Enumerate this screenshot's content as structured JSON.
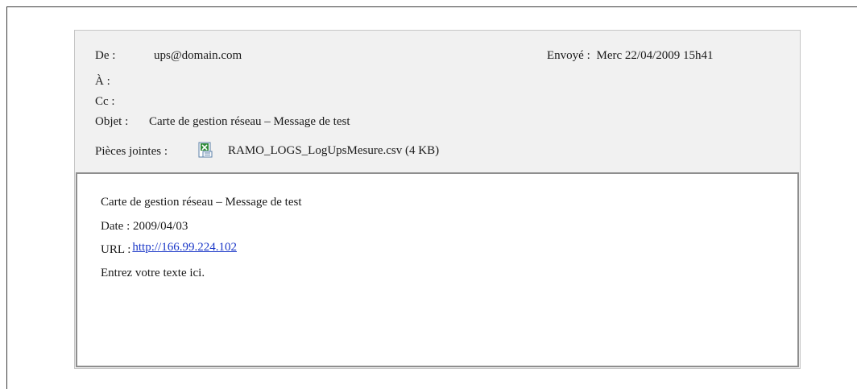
{
  "header": {
    "from_label": "De :",
    "from_value": "ups@domain.com",
    "sent_label": "Envoyé :",
    "sent_value": "Merc 22/04/2009 15h41",
    "to_label": "À :",
    "cc_label": "Cc :",
    "subject_label": "Objet :",
    "subject_value": "Carte de gestion réseau – Message de test",
    "attachments_label": "Pièces jointes :",
    "attachment_icon": "excel-csv-file-icon",
    "attachment_name": "RAMO_LOGS_LogUpsMesure.csv (4 KB)"
  },
  "body": {
    "line1": "Carte de  gestion réseau – Message de test",
    "date_line": "Date : 2009/04/03",
    "url_label": "URL :",
    "url_link": "http://166.99.224.102",
    "line4": "Entrez votre texte ici."
  },
  "colors": {
    "link": "#1a37c8",
    "header_bg": "#f1f1f1",
    "body_border": "#8e8e8e"
  }
}
